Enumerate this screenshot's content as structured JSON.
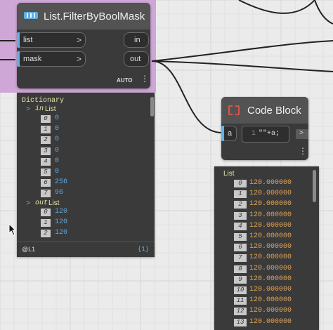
{
  "canvas": {
    "background": "#ebebeb",
    "group_color": "#cfa7d6",
    "accent": "#5fb0e3",
    "number_color": "#5fa9e0",
    "string_color": "#e0a45a"
  },
  "filter_node": {
    "icon": "list-icon",
    "title": "List.FilterByBoolMask",
    "inputs": [
      {
        "label": "list",
        "arrow": ">"
      },
      {
        "label": "mask",
        "arrow": ">"
      }
    ],
    "outputs": [
      {
        "label": "in"
      },
      {
        "label": "out"
      }
    ],
    "lacing": "AUTO",
    "menu": "⋮"
  },
  "filter_preview": {
    "root_label": "Dictionary",
    "in_key": "in",
    "in_type": "List",
    "in_rows": [
      {
        "index": "0",
        "value": "0"
      },
      {
        "index": "1",
        "value": "0"
      },
      {
        "index": "2",
        "value": "0"
      },
      {
        "index": "3",
        "value": "0"
      },
      {
        "index": "4",
        "value": "0"
      },
      {
        "index": "5",
        "value": "0"
      },
      {
        "index": "6",
        "value": "256"
      },
      {
        "index": "7",
        "value": "96"
      }
    ],
    "out_key": "out",
    "out_type": "List",
    "out_rows": [
      {
        "index": "0",
        "value": "120"
      },
      {
        "index": "1",
        "value": "120"
      },
      {
        "index": "2",
        "value": "120"
      }
    ],
    "footer_left": "@L1",
    "footer_right": "{1}"
  },
  "code_block_node": {
    "icon": "code-block-icon",
    "title": "Code Block",
    "input_label": "a",
    "line_number": "1",
    "code": "\"\"+a;",
    "output_arrow": ">",
    "menu": "⋮"
  },
  "code_preview": {
    "root_label": "List",
    "rows": [
      {
        "index": "0",
        "value": "120.000000"
      },
      {
        "index": "1",
        "value": "120.000000"
      },
      {
        "index": "2",
        "value": "120.000000"
      },
      {
        "index": "3",
        "value": "120.000000"
      },
      {
        "index": "4",
        "value": "120.000000"
      },
      {
        "index": "5",
        "value": "120.000000"
      },
      {
        "index": "6",
        "value": "120.000000"
      },
      {
        "index": "7",
        "value": "120.000000"
      },
      {
        "index": "8",
        "value": "120.000000"
      },
      {
        "index": "9",
        "value": "120.000000"
      },
      {
        "index": "10",
        "value": "120.000000"
      },
      {
        "index": "11",
        "value": "120.000000"
      },
      {
        "index": "12",
        "value": "120.000000"
      },
      {
        "index": "13",
        "value": "120.000000"
      }
    ]
  }
}
